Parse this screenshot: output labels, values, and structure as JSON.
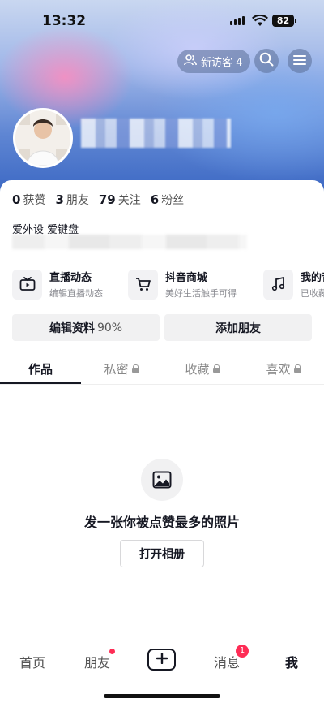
{
  "status_bar": {
    "time": "13:32",
    "battery": "82"
  },
  "header": {
    "visitors_label": "新访客 4",
    "icons": [
      "visitors-icon",
      "search-icon",
      "menu-icon"
    ]
  },
  "stats": [
    {
      "value": "0",
      "label": "获赞"
    },
    {
      "value": "3",
      "label": "朋友"
    },
    {
      "value": "79",
      "label": "关注"
    },
    {
      "value": "6",
      "label": "粉丝"
    }
  ],
  "bio": {
    "line1": "爱外设 爱键盘"
  },
  "features": [
    {
      "title": "直播动态",
      "subtitle": "编辑直播动态",
      "icon": "tv-icon"
    },
    {
      "title": "抖音商城",
      "subtitle": "美好生活触手可得",
      "icon": "cart-icon"
    },
    {
      "title": "我的音",
      "subtitle": "已收藏",
      "icon": "music-icon"
    }
  ],
  "buttons": {
    "edit_profile": "编辑资料",
    "edit_percent": "90%",
    "add_friend": "添加朋友"
  },
  "tabs": [
    {
      "label": "作品",
      "active": true,
      "locked": false
    },
    {
      "label": "私密",
      "active": false,
      "locked": true
    },
    {
      "label": "收藏",
      "active": false,
      "locked": true
    },
    {
      "label": "喜欢",
      "active": false,
      "locked": true
    }
  ],
  "empty_state": {
    "text": "发一张你被点赞最多的照片",
    "button": "打开相册",
    "icon": "image-icon"
  },
  "bottom_nav": {
    "home": "首页",
    "friends": "朋友",
    "messages": "消息",
    "messages_badge": "1",
    "me": "我"
  },
  "colors": {
    "accent": "#fe2c55",
    "text": "#161823"
  }
}
